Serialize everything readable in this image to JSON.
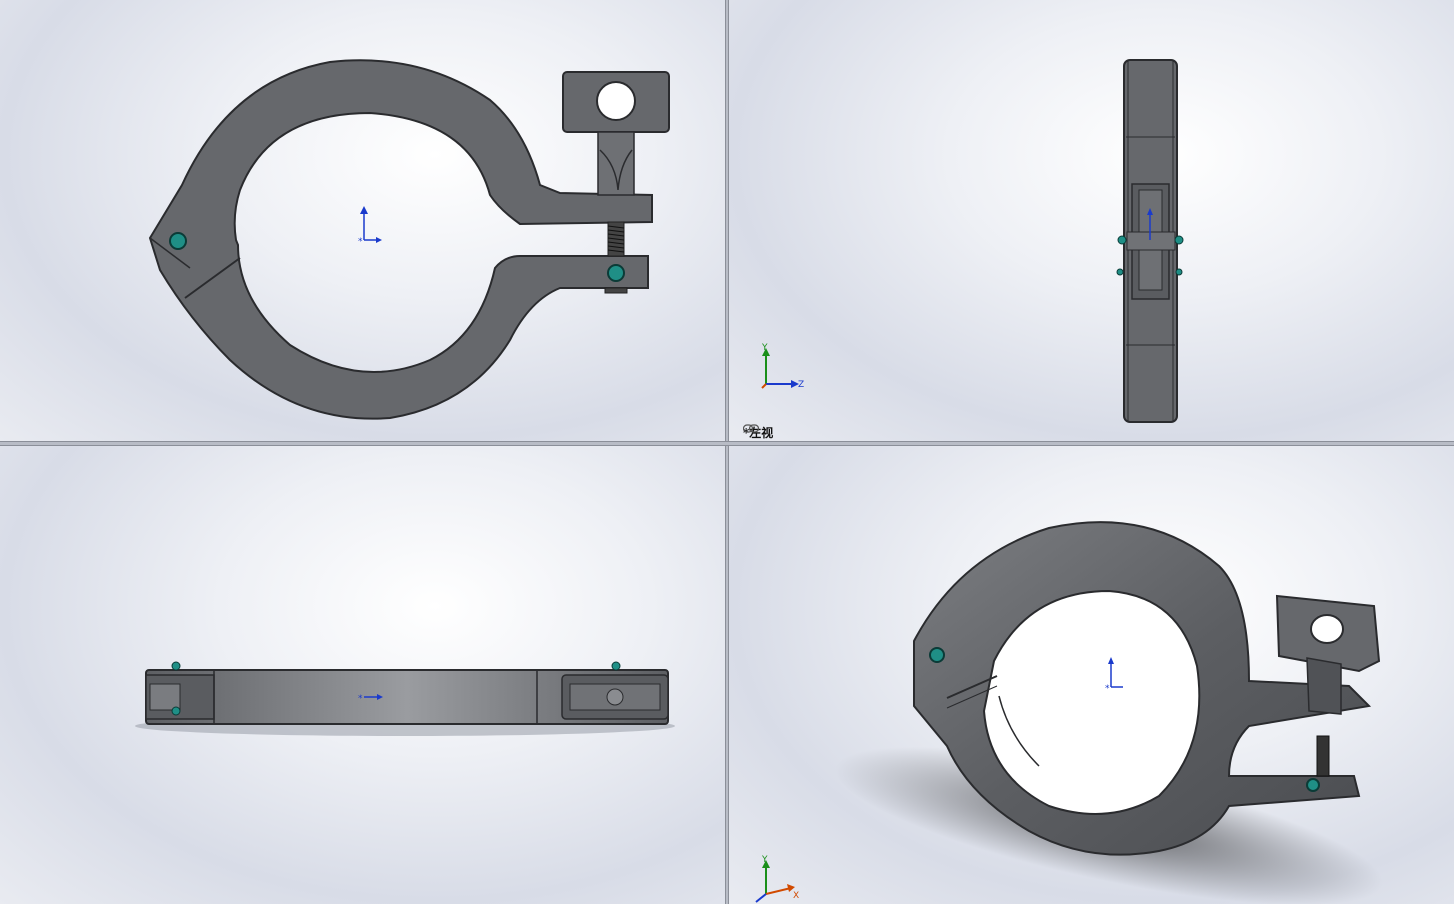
{
  "viewports": {
    "top_left": {
      "name": "front-view"
    },
    "top_right": {
      "name": "left-view",
      "label": "*左视",
      "triad": {
        "y": "Y",
        "z": "Z"
      }
    },
    "bottom_left": {
      "name": "top-view"
    },
    "bottom_right": {
      "name": "isometric-view",
      "triad": {
        "y": "Y",
        "x": "X"
      }
    }
  },
  "colors": {
    "part_fill": "#66686c",
    "part_edge": "#2a2b2e",
    "pin": "#1f8f86",
    "axis_y": "#1a8f1a",
    "axis_z": "#1a3acc",
    "axis_x": "#d14a00",
    "origin": "#1a3acc"
  },
  "icons": [
    "link-icon",
    "coordinate-triad-icon",
    "origin-icon"
  ]
}
